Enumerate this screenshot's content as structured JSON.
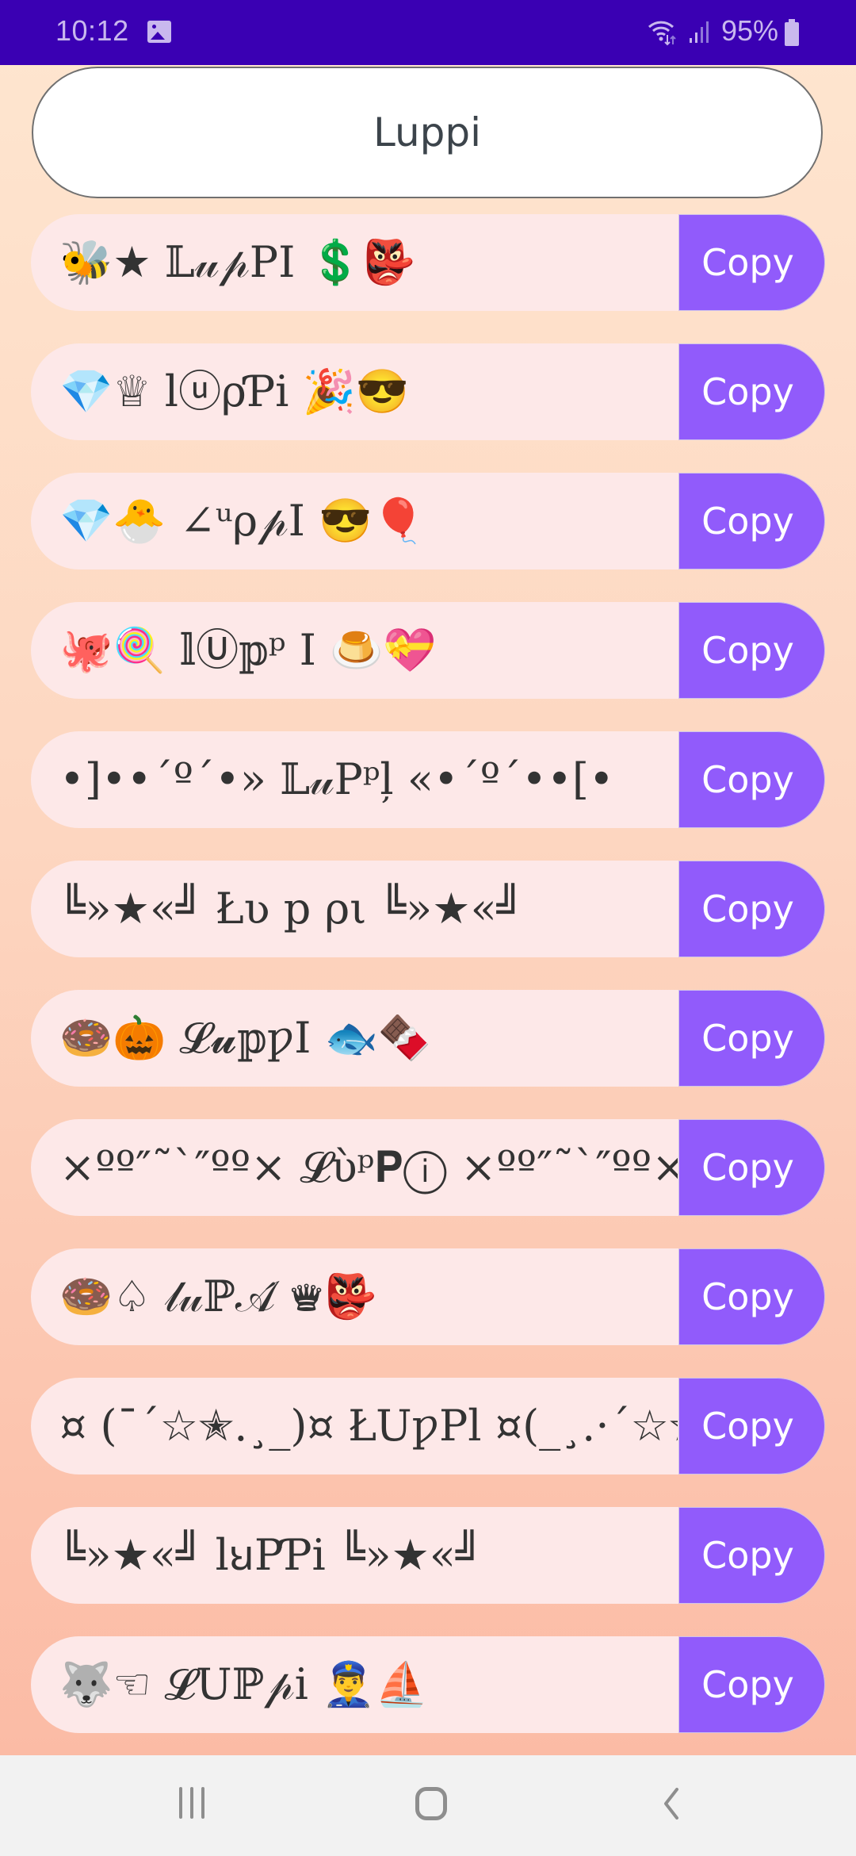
{
  "status_bar": {
    "time": "10:12",
    "notification_icon": "gallery-icon",
    "wifi_icon": "wifi-icon",
    "signal_icon": "signal-icon",
    "battery_percent": "95%",
    "battery_icon": "battery-icon",
    "colors": {
      "background": "#3a00b3",
      "foreground": "#c9b8ee"
    }
  },
  "input": {
    "value": "Luppi",
    "placeholder": ""
  },
  "theme": {
    "accent": "#915bfb",
    "row_background": "#fde8e8",
    "gradient_top": "#fee6d0",
    "gradient_bottom": "#fbb8a2"
  },
  "rows": [
    {
      "text": "🐝★ 𝕃𝓊𝓅PI 💲👺",
      "copy_label": "Copy"
    },
    {
      "text": "💎♕ lⓤρƤi 🎉😎",
      "copy_label": "Copy"
    },
    {
      "text": "💎🐣 ∠ᵘρ𝓅I 😎🎈",
      "copy_label": "Copy"
    },
    {
      "text": "🐙🍭 𝕝Ⓤ𝕡ᵖ I 🍮💝",
      "copy_label": "Copy"
    },
    {
      "text": "•]••´º´•» 𝕃𝓊Pᵖļ «•´º´••[•",
      "copy_label": "Copy"
    },
    {
      "text": "╚»★«╝ Łʋ p ρι ╚»★«╝",
      "copy_label": "Copy"
    },
    {
      "text": "🍩🎃 𝓛𝓾𝕡ƿI 🐟🍫",
      "copy_label": "Copy"
    },
    {
      "text": "×ºº″˜`″ºº× 𝓛ὺᵖ𝐏ⓘ ×ºº″˜`″ºº×",
      "copy_label": "Copy"
    },
    {
      "text": "🍩♤ 𝓁𝓊ℙ𝒜́ ♛👺",
      "copy_label": "Copy"
    },
    {
      "text": "¤ (¯´☆✭.¸_)¤ ŁUƿPl ¤(_¸.·´☆✭`¯)¤",
      "copy_label": "Copy"
    },
    {
      "text": "╚»★«╝ lꞟPƤi ╚»★«╝",
      "copy_label": "Copy"
    },
    {
      "text": "🐺☜ 𝓛Uℙ𝓅i 👮‍♂️⛵",
      "copy_label": "Copy"
    }
  ],
  "nav_bar": {
    "recents_icon": "recents-icon",
    "home_icon": "home-icon",
    "back_icon": "back-icon"
  }
}
